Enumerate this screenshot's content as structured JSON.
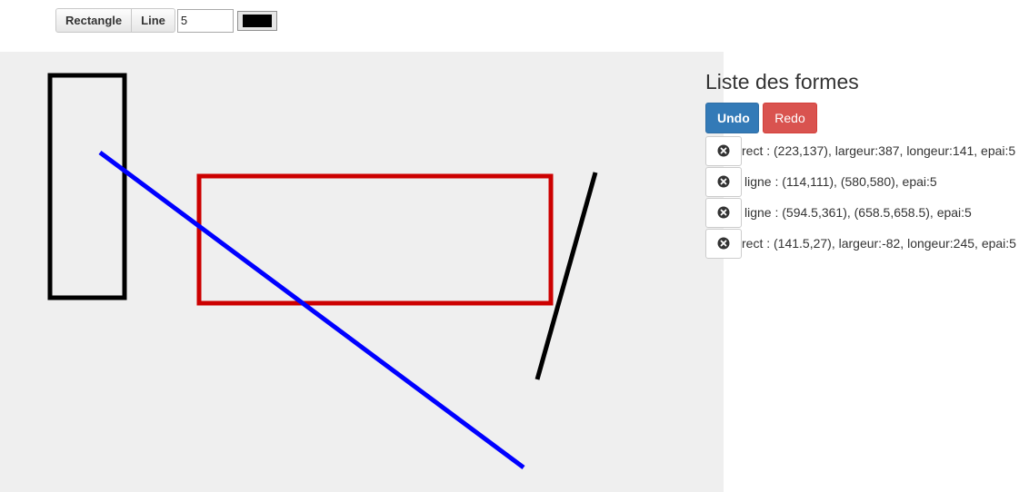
{
  "toolbar": {
    "rectangle_label": "Rectangle",
    "line_label": "Line",
    "width_value": "5",
    "color_value": "#000000"
  },
  "panel": {
    "title": "Liste des formes",
    "undo_label": "Undo",
    "redo_label": "Redo",
    "delete_icon": "remove-sign-icon",
    "shapes": [
      {
        "text": "rect : (223,137), largeur:387, longeur:141, epai:5"
      },
      {
        "text": "ligne : (114,111), (580,580), epai:5"
      },
      {
        "text": "ligne : (594.5,361), (658.5,658.5), epai:5"
      },
      {
        "text": "rect : (141.5,27), largeur:-82, longeur:245, epai:5"
      }
    ]
  },
  "colors": {
    "canvas_bg": "#efefef",
    "shape_black": "#000000",
    "shape_red": "#cc0000",
    "shape_blue": "#0000ff",
    "undo_bg": "#337ab7",
    "redo_bg": "#d9534f"
  }
}
